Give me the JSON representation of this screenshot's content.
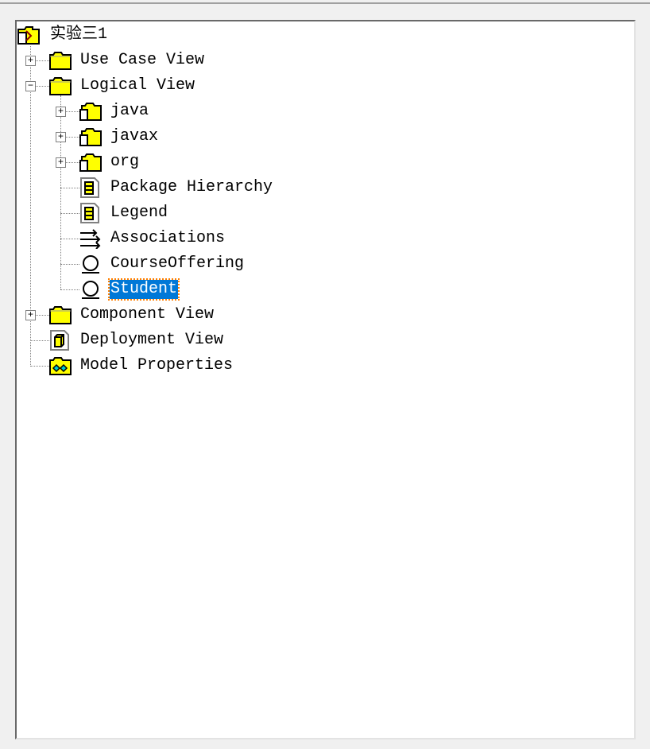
{
  "tree": {
    "root": {
      "label": "实验三1",
      "icon": "model-icon"
    },
    "items": [
      {
        "label": "Use Case View",
        "icon": "folder-icon",
        "expander": "+"
      },
      {
        "label": "Logical View",
        "icon": "folder-icon",
        "expander": "−"
      },
      {
        "label": "java",
        "icon": "package-icon",
        "expander": "+"
      },
      {
        "label": "javax",
        "icon": "package-icon",
        "expander": "+"
      },
      {
        "label": "org",
        "icon": "package-icon",
        "expander": "+"
      },
      {
        "label": "Package Hierarchy",
        "icon": "class-diagram-icon"
      },
      {
        "label": "Legend",
        "icon": "class-diagram-icon"
      },
      {
        "label": "Associations",
        "icon": "associations-icon"
      },
      {
        "label": "CourseOffering",
        "icon": "class-icon"
      },
      {
        "label": "Student",
        "icon": "class-icon",
        "selected": true
      },
      {
        "label": "Component View",
        "icon": "folder-icon",
        "expander": "+"
      },
      {
        "label": "Deployment View",
        "icon": "deployment-diagram-icon"
      },
      {
        "label": "Model Properties",
        "icon": "model-properties-icon"
      }
    ]
  },
  "colors": {
    "selection": "#0078d7",
    "folder": "#ffff00"
  }
}
